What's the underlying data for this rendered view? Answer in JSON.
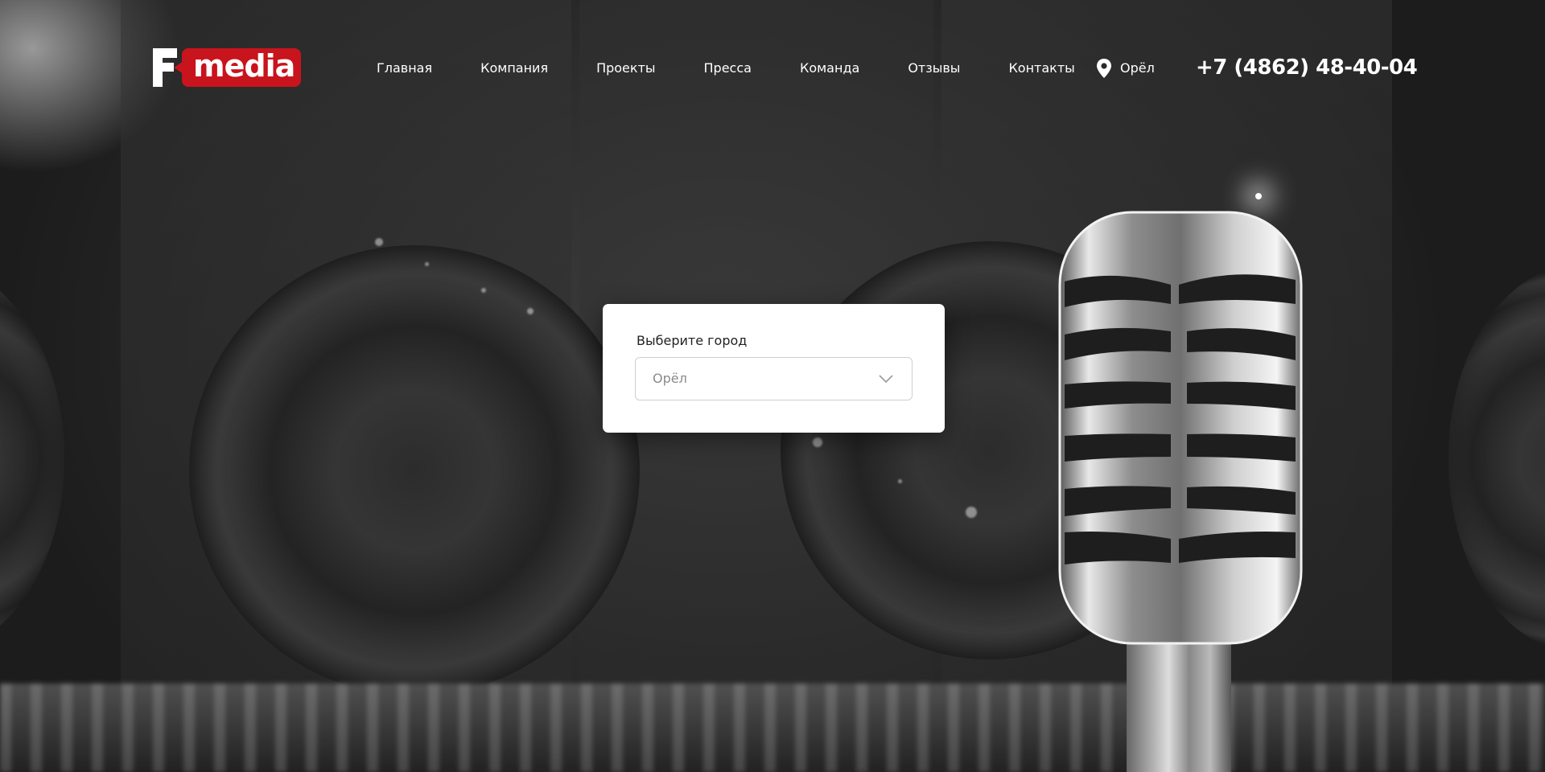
{
  "header": {
    "logo": {
      "letter": "F",
      "text": "media",
      "brand_color": "#c8141c"
    },
    "nav": [
      {
        "label": "Главная"
      },
      {
        "label": "Компания"
      },
      {
        "label": "Проекты"
      },
      {
        "label": "Пресса"
      },
      {
        "label": "Команда"
      },
      {
        "label": "Отзывы"
      },
      {
        "label": "Контакты"
      }
    ],
    "city": {
      "icon": "map-pin-icon",
      "label": "Орёл"
    },
    "phone": "+7 (4862) 48-40-04"
  },
  "city_modal": {
    "title": "Выберите город",
    "select": {
      "value": "Орёл",
      "icon": "chevron-down-icon"
    }
  },
  "colors": {
    "text_on_dark": "#ffffff",
    "modal_bg": "#ffffff",
    "select_border": "#cfcfcf",
    "select_text": "#8a8a8a"
  }
}
